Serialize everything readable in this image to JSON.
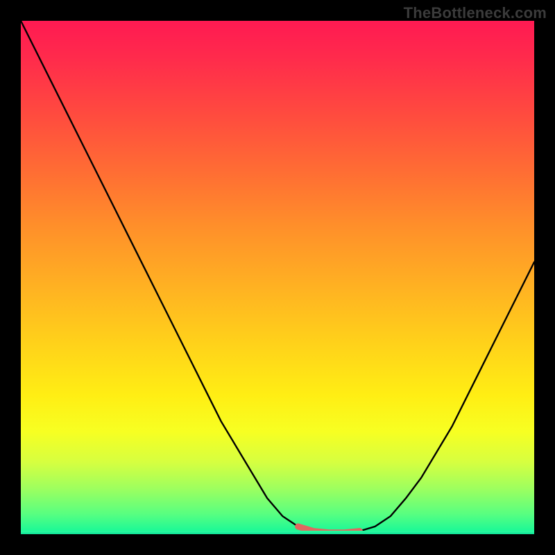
{
  "watermark": "TheBottleneck.com",
  "colors": {
    "frame": "#000000",
    "curve_stroke": "#000000",
    "accent_segment": "#e06860",
    "gradient_top": "#ff1a52",
    "gradient_bottom": "#11f79b"
  },
  "chart_data": {
    "type": "line",
    "title": "",
    "xlabel": "",
    "ylabel": "",
    "xlim": [
      0,
      100
    ],
    "ylim": [
      0,
      100
    ],
    "x": [
      0,
      3,
      6,
      9,
      12,
      15,
      18,
      21,
      24,
      27,
      30,
      33,
      36,
      39,
      42,
      45,
      48,
      51,
      54,
      57,
      60,
      63,
      66,
      69,
      72,
      75,
      78,
      81,
      84,
      87,
      90,
      93,
      96,
      100
    ],
    "values": [
      100,
      94,
      88,
      82,
      76,
      70,
      64,
      58,
      52,
      46,
      40,
      34,
      28,
      22,
      17,
      12,
      7,
      3.5,
      1.5,
      0.6,
      0.3,
      0.3,
      0.6,
      1.5,
      3.5,
      7,
      11,
      16,
      21,
      27,
      33,
      39,
      45,
      53
    ],
    "accent_range_x": [
      54,
      66
    ],
    "description": "V-shaped bottleneck curve descending from top-left to a flat minimum near x≈54–66 then rising toward the right over a vertical red→green heat gradient."
  }
}
